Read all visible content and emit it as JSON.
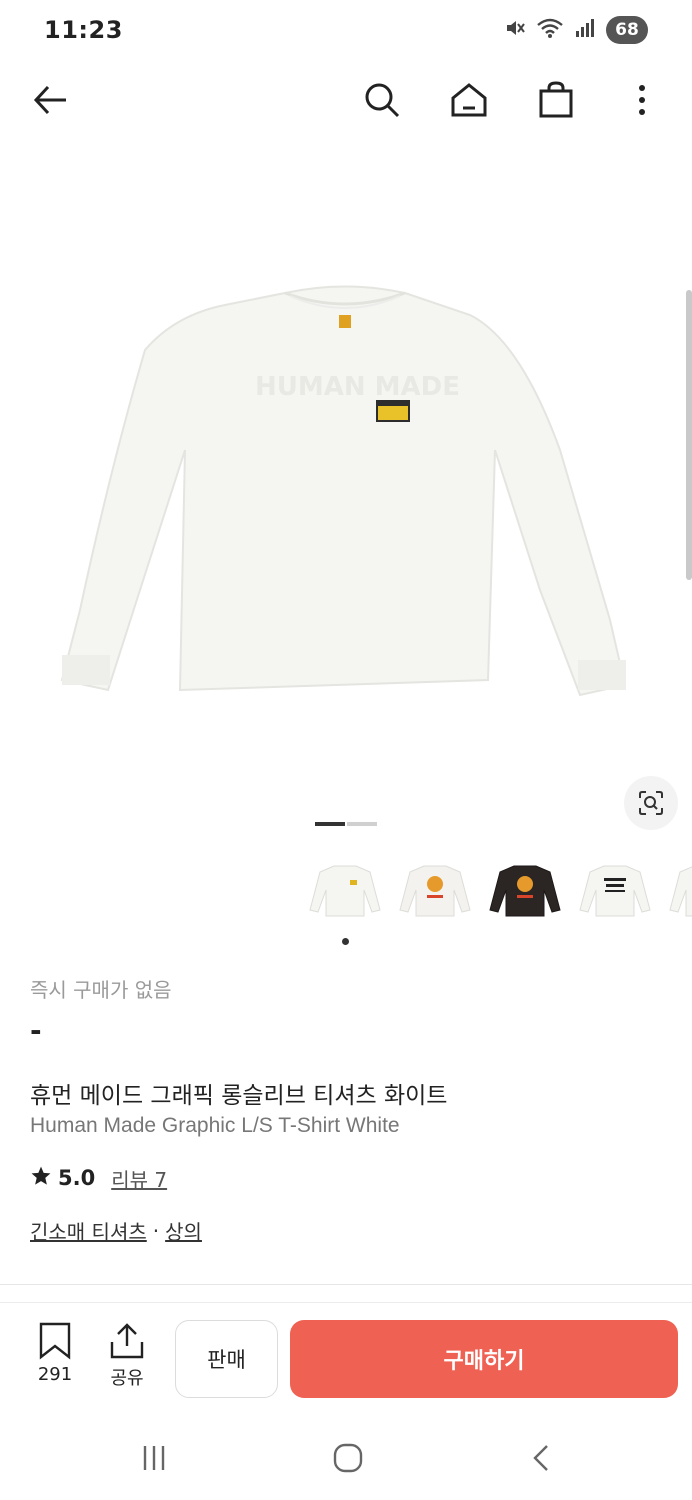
{
  "status_bar": {
    "time": "11:23",
    "battery": "68",
    "icons": [
      "mute-icon",
      "wifi-icon",
      "signal-icon"
    ]
  },
  "top_nav": {
    "icons": [
      "back-arrow-icon",
      "search-icon",
      "home-icon",
      "shopping-bag-icon",
      "more-vertical-icon"
    ]
  },
  "product": {
    "image": {
      "description_icon": "white-long-sleeve-tshirt",
      "active_page": 1,
      "page_count": 2
    },
    "thumbnails": [
      "white-tshirt-front-thumb",
      "white-tshirt-tiger-thumb",
      "black-tshirt-tiger-thumb",
      "white-tshirt-dry-alls-thumb",
      "white-tshirt-partial-thumb"
    ],
    "instant_purchase_note": "즉시 구매가 없음",
    "price": "-",
    "name_ko": "휴먼 메이드 그래픽 롱슬리브 티셔츠 화이트",
    "name_en": "Human Made Graphic L/S T-Shirt White",
    "rating": "5.0",
    "review_link": "리뷰 7",
    "category_primary": "긴소매 티셔츠",
    "category_separator": "·",
    "category_secondary": "상의"
  },
  "bottom_bar": {
    "bookmark_count": "291",
    "share_label": "공유",
    "sell_label": "판매",
    "buy_label": "구매하기",
    "buy_color": "#ef6253"
  },
  "system_nav": {
    "icons": [
      "recent-apps-icon",
      "home-circle-icon",
      "back-chevron-icon"
    ]
  }
}
